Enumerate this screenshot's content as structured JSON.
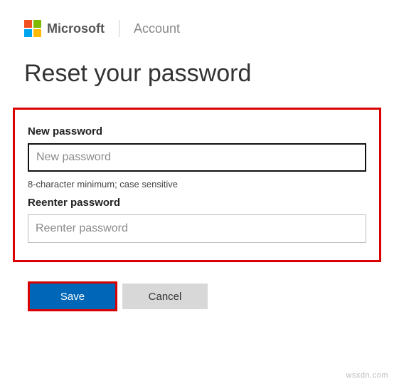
{
  "header": {
    "brand": "Microsoft",
    "section": "Account"
  },
  "page_title": "Reset your password",
  "form": {
    "new_password": {
      "label": "New password",
      "placeholder": "New password",
      "helper": "8-character minimum; case sensitive"
    },
    "reenter_password": {
      "label": "Reenter password",
      "placeholder": "Reenter password"
    }
  },
  "buttons": {
    "save": "Save",
    "cancel": "Cancel"
  },
  "watermark": "wsxdn.com",
  "colors": {
    "highlight": "#d80000",
    "primary": "#0067b8"
  }
}
